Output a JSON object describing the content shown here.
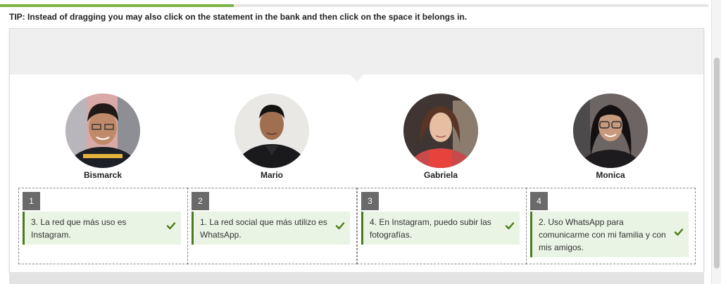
{
  "progress": {
    "percent": 33
  },
  "tip": "TIP: Instead of dragging you may also click on the statement in the bank and then click on the space it belongs in.",
  "people": [
    {
      "name": "Bismarck"
    },
    {
      "name": "Mario"
    },
    {
      "name": "Gabriela"
    },
    {
      "name": "Monica"
    }
  ],
  "drop_zones": [
    {
      "number": "1",
      "statement": "3. La red que más uso es Instagram.",
      "status": "correct"
    },
    {
      "number": "2",
      "statement": "1. La red social que más utilizo es WhatsApp.",
      "status": "correct"
    },
    {
      "number": "3",
      "statement": "4. En Instagram, puedo subir las fotografías.",
      "status": "correct"
    },
    {
      "number": "4",
      "statement": "2. Uso WhatsApp para comunicarme con mi familia y con mis amigos.",
      "status": "correct"
    }
  ],
  "colors": {
    "accent": "#7cb342",
    "correct_bg": "#eaf4e4",
    "correct_border": "#4a7c1d",
    "check": "#4a7c1d"
  }
}
